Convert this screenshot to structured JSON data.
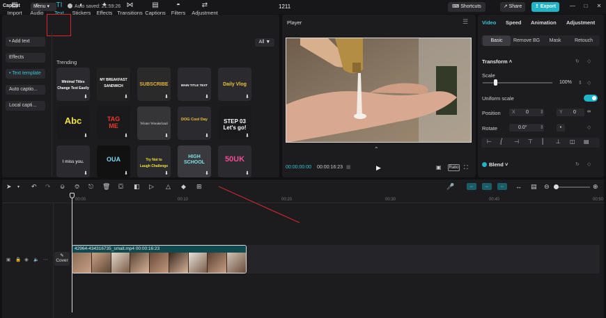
{
  "titlebar": {
    "logo": "CapCut",
    "menu_label": "Menu",
    "autosave": "Auto saved: 21:59:26",
    "project_title": "1211",
    "shortcuts_label": "Shortcuts",
    "share_label": "Share",
    "export_label": "Export",
    "window_controls": [
      "—",
      "□",
      "✕"
    ]
  },
  "tabs": [
    {
      "label": "Import",
      "icon": "import-icon"
    },
    {
      "label": "Audio",
      "icon": "audio-icon"
    },
    {
      "label": "Text",
      "icon": "text-icon",
      "active": true
    },
    {
      "label": "Stickers",
      "icon": "sticker-icon"
    },
    {
      "label": "Effects",
      "icon": "effects-icon"
    },
    {
      "label": "Transitions",
      "icon": "transitions-icon"
    },
    {
      "label": "Captions",
      "icon": "captions-icon"
    },
    {
      "label": "Filters",
      "icon": "filters-icon"
    },
    {
      "label": "Adjustment",
      "icon": "adjustment-icon"
    }
  ],
  "sidebar": [
    {
      "label": "• Add text"
    },
    {
      "label": "Effects"
    },
    {
      "label": "• Text template",
      "active": true
    },
    {
      "label": "Auto captio..."
    },
    {
      "label": "Local capti..."
    }
  ],
  "library": {
    "filter_label": "All",
    "section_title": "Trending",
    "tiles": [
      {
        "text": "Minimal Titles\nChange Text Easily"
      },
      {
        "text": "MY BREAKFAST\nSANDWICH"
      },
      {
        "text": "SUBSCRIBE"
      },
      {
        "text": "MAIN TITLE TEXT"
      },
      {
        "text": "Daily Vlog"
      },
      {
        "text": "Abc"
      },
      {
        "text": "TAG\nME"
      },
      {
        "text": "Winter Wonderland"
      },
      {
        "text": "DOG Cool Day"
      },
      {
        "text": "STEP 03\nLet's go!"
      },
      {
        "text": "I miss you."
      },
      {
        "text": "OUA"
      },
      {
        "text": "Try Not to\nLaugh Challenge"
      },
      {
        "text": "HIGH\nSCHOOL"
      },
      {
        "text": "50UK"
      }
    ]
  },
  "player": {
    "title": "Player",
    "current_time": "00:00:00:00",
    "duration": "00:00:16:23",
    "ratio_label": "Ratio"
  },
  "inspector": {
    "tabs": [
      "Video",
      "Speed",
      "Animation",
      "Adjustment"
    ],
    "subtabs": [
      "Basic",
      "Remove BG",
      "Mask",
      "Retouch"
    ],
    "transform_label": "Transform",
    "scale_label": "Scale",
    "scale_value": "100%",
    "scale_level": 0.18,
    "uniform_scale_label": "Uniform scale",
    "position_label": "Position",
    "x_label": "X",
    "x_value": "0",
    "y_label": "Y",
    "y_value": "0",
    "rotate_label": "Rotate",
    "rotate_value": "0.0°",
    "blend_label": "Blend"
  },
  "timeline": {
    "ruler": [
      "00:00",
      "00:10",
      "00:20",
      "00:30",
      "00:40",
      "00:50"
    ],
    "clip_label": "42964-434316735_small.mp4  00:00:16:23",
    "cover_label": "Cover"
  }
}
